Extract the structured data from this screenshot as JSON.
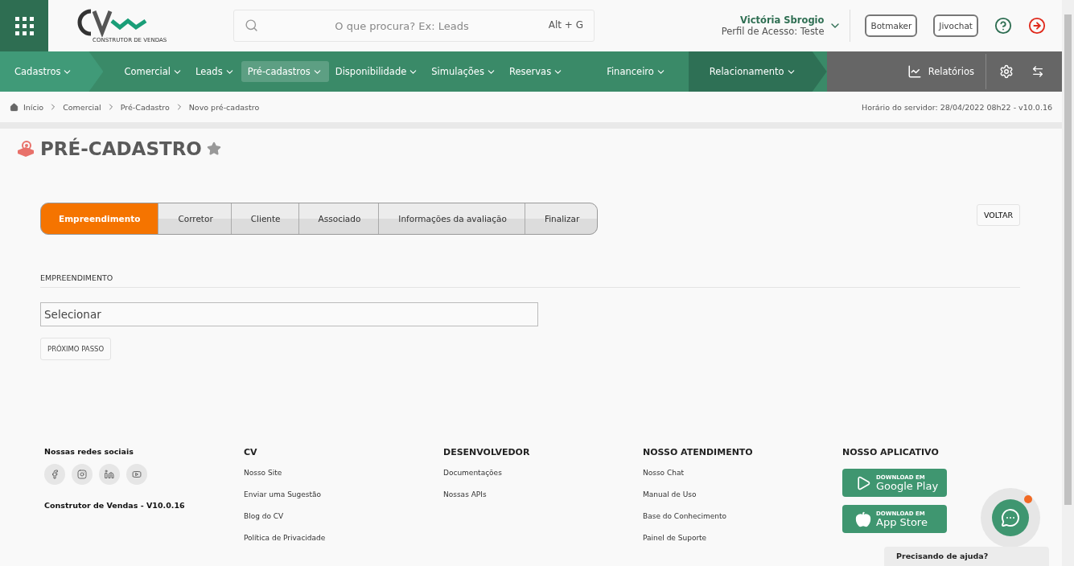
{
  "header": {
    "search": {
      "placeholder": "O que procura? Ex: Leads",
      "shortcut": "Alt + G"
    },
    "logo": {
      "tagline": "CONSTRUTOR DE VENDAS"
    },
    "user": {
      "name": "Victória Sbrogio",
      "profile": "Perfil de Acesso: Teste"
    },
    "buttons": [
      "Botmaker",
      "Jivochat"
    ]
  },
  "nav": {
    "segments": [
      {
        "kind": "light",
        "items": [
          {
            "label": "Cadastros",
            "selected": false
          }
        ]
      },
      {
        "kind": "mid",
        "items": [
          {
            "label": "Comercial",
            "selected": false
          },
          {
            "label": "Leads",
            "selected": false
          },
          {
            "label": "Pré-cadastros",
            "selected": true
          },
          {
            "label": "Disponibilidade",
            "selected": false
          },
          {
            "label": "Simulações",
            "selected": false
          },
          {
            "label": "Reservas",
            "selected": false
          }
        ]
      },
      {
        "kind": "mid",
        "items": [
          {
            "label": "Financeiro",
            "selected": false
          }
        ]
      },
      {
        "kind": "dark",
        "items": [
          {
            "label": "Relacionamento",
            "selected": false
          }
        ]
      }
    ],
    "reports": "Relatórios"
  },
  "breadcrumb": {
    "items": [
      "Início",
      "Comercial",
      "Pré-Cadastro",
      "Novo pré-cadastro"
    ],
    "server_time": "Horário do servidor: 28/04/2022 08h22 - v10.0.16"
  },
  "page": {
    "title": "PRÉ-CADASTRO",
    "favorite": false,
    "steps": [
      {
        "label": "Empreendimento",
        "selected": true
      },
      {
        "label": "Corretor",
        "selected": false
      },
      {
        "label": "Cliente",
        "selected": false
      },
      {
        "label": "Associado",
        "selected": false
      },
      {
        "label": "Informações da avaliação",
        "selected": false
      },
      {
        "label": "Finalizar",
        "selected": false
      }
    ],
    "back_button": "VOLTAR",
    "section": "EMPREENDIMENTO",
    "select": {
      "placeholder": "Selecionar"
    },
    "next_button": "PRÓXIMO PASSO"
  },
  "footer": {
    "social_title": "Nossas redes sociais",
    "version": "Construtor de Vendas - V10.0.16",
    "columns": [
      {
        "title": "CV",
        "links": [
          "Nosso Site",
          "Enviar uma Sugestão",
          "Blog do CV",
          "Política de Privacidade"
        ]
      },
      {
        "title": "DESENVOLVEDOR",
        "links": [
          "Documentações",
          "Nossas APIs"
        ]
      },
      {
        "title": "NOSSO ATENDIMENTO",
        "links": [
          "Nosso Chat",
          "Manual de Uso",
          "Base do Conhecimento",
          "Painel de Suporte"
        ]
      }
    ],
    "app_title": "NOSSO APLICATIVO",
    "stores": [
      {
        "kind": "google",
        "small": "DOWNLOAD EM",
        "name": "Google Play"
      },
      {
        "kind": "apple",
        "small": "DOWNLOAD EM",
        "name": "App Store"
      }
    ]
  },
  "chat": {
    "unread": true,
    "prompt": "Precisando de ajuda?"
  }
}
